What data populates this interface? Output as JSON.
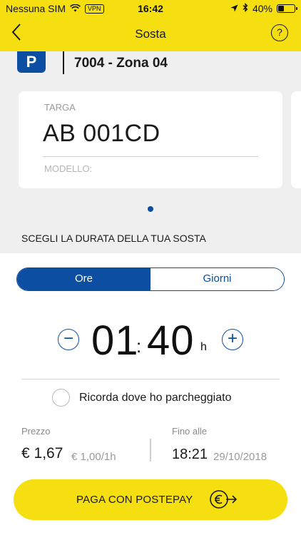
{
  "status_bar": {
    "carrier": "Nessuna SIM",
    "vpn": "VPN",
    "time": "16:42",
    "battery": "40%",
    "battery_level": 0.4
  },
  "nav": {
    "title": "Sosta",
    "back_icon": "chevron-left-icon",
    "help_icon": "question-circle-icon",
    "help_glyph": "?"
  },
  "zone": {
    "badge": "P",
    "label": "7004 - Zona 04"
  },
  "vehicle_card": {
    "targa_label": "TARGA",
    "targa_value": "AB 001CD",
    "modello_label": "MODELLO:"
  },
  "duration_section_label": "SCEGLI LA DURATA DELLA TUA SOSTA",
  "segmented": {
    "options": [
      "Ore",
      "Giorni"
    ],
    "selected": "Ore"
  },
  "duration": {
    "hours": "01",
    "separator": ":",
    "minutes": "40",
    "unit": "h",
    "minus_glyph": "−",
    "plus_glyph": "+"
  },
  "remember_label": "Ricorda dove ho parcheggiato",
  "price": {
    "label": "Prezzo",
    "value": "€ 1,67",
    "rate": "€ 1,00/1h"
  },
  "until": {
    "label": "Fino alle",
    "time": "18:21",
    "date": "29/10/2018"
  },
  "pay_button": {
    "label": "PAGA CON POSTEPAY",
    "icon": "euro-arrow-icon"
  },
  "colors": {
    "brand_yellow": "#f6df10",
    "accent_blue": "#0b4ea2",
    "background_gray": "#efefef"
  }
}
